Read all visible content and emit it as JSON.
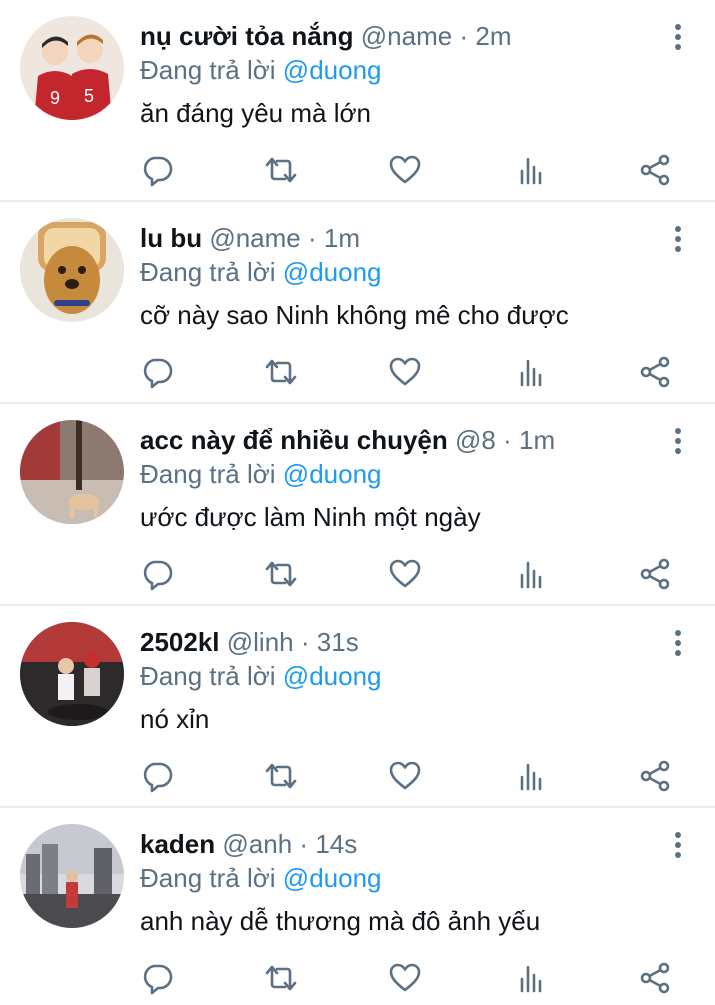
{
  "reply_prefix": "Đang trả lời",
  "colors": {
    "name": "#0f1419",
    "muted": "#5b7083",
    "link": "#1d9bf0",
    "divider": "#e6ecf0"
  },
  "icons": [
    "more-vertical-icon",
    "reply-icon",
    "retweet-icon",
    "like-icon",
    "stats-icon",
    "share-icon"
  ],
  "tweets": [
    {
      "name": "nụ cười tỏa nắng",
      "handle": "@name",
      "time": "2m",
      "mention": "@duong",
      "text": "ăn đáng yêu mà lớn"
    },
    {
      "name": "lu bu",
      "handle": "@name",
      "time": "1m",
      "mention": "@duong",
      "text": "cỡ này sao Ninh không mê cho được"
    },
    {
      "name": "acc này để nhiều chuyện",
      "handle": "@8",
      "time": "1m",
      "mention": "@duong",
      "text": "ước được làm Ninh một ngày"
    },
    {
      "name": "2502kl",
      "handle": "@linh",
      "time": "31s",
      "mention": "@duong",
      "text": "nó xỉn"
    },
    {
      "name": "kaden",
      "handle": "@anh",
      "time": "14s",
      "mention": "@duong",
      "text": "anh này dễ thương mà đô ảnh yếu"
    }
  ]
}
